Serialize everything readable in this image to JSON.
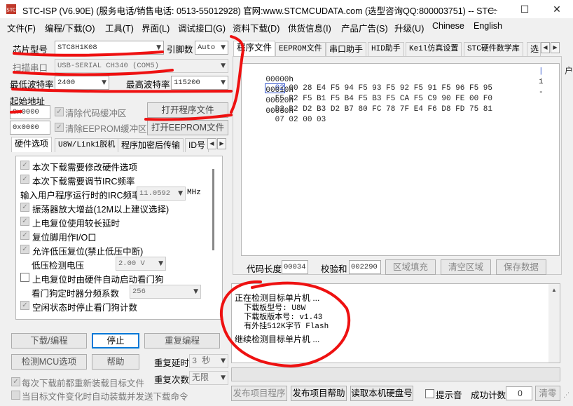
{
  "window": {
    "title": "STC-ISP (V6.90E) (服务电话/销售电话: 0513-55012928) 官网:www.STCMCUDATA.com  (选型咨询QQ:800003751) -- STC:",
    "minimize": "—",
    "maximize": "☐",
    "close": "✕"
  },
  "menu": [
    "文件(F)",
    "编程/下载(O)",
    "工具(T)",
    "界面(L)",
    "调试接口(G)",
    "资料下载(D)",
    "供货信息(I)",
    "产品广告(S)",
    "升级(U)",
    "Chinese",
    "English"
  ],
  "left": {
    "chip_label": "芯片型号",
    "chip_value": "STC8H1K08",
    "pin_label": "引脚数",
    "pin_value": "Auto",
    "port_label": "扫描串口",
    "port_value": "USB-SERIAL CH340 (COM5)",
    "min_baud_label": "最低波特率",
    "min_baud_value": "2400",
    "max_baud_label": "最高波特率",
    "max_baud_value": "115200",
    "start_addr_label": "起始地址",
    "addr1": "0x0000",
    "clear_code": "清除代码缓冲区",
    "open_program": "打开程序文件",
    "addr2": "0x0000",
    "clear_eeprom": "清除EEPROM缓冲区",
    "open_eeprom": "打开EEPROM文件"
  },
  "left_tabs": [
    "硬件选项",
    "U8W/Link1脱机",
    "程序加密后传输",
    "ID号"
  ],
  "options": {
    "o1": "本次下载需要修改硬件选项",
    "o2": "本次下载需要调节IRC频率",
    "irc_label": "输入用户程序运行时的IRC频率",
    "irc_value": "11.0592",
    "irc_unit": "MHz",
    "o3": "振荡器放大增益(12M以上建议选择)",
    "o4": "上电复位使用较长延时",
    "o5": "复位脚用作I/O口",
    "o6": "允许低压复位(禁止低压中断)",
    "lv_label": "低压检测电压",
    "lv_value": "2.00 V",
    "o7": "上电复位时由硬件自动启动看门狗",
    "wdt_label": "看门狗定时器分频系数",
    "wdt_value": "256",
    "o8": "空闲状态时停止看门狗计数"
  },
  "buttons": {
    "download": "下载/编程",
    "stop": "停止",
    "reprogram": "重复编程",
    "detect": "检测MCU选项",
    "help": "帮助",
    "repeat_delay_label": "重复延时",
    "repeat_delay_value": "3 秒",
    "repeat_count_label": "重复次数",
    "repeat_count_value": "无限",
    "reload_each": "每次下载前都重新装载目标文件",
    "auto_load": "当目标文件变化时自动装载并发送下载命令"
  },
  "right_tabs": [
    "程序文件",
    "EEPROM文件",
    "串口助手",
    "HID助手",
    "Keil仿真设置",
    "STC硬件数学库",
    "选"
  ],
  "hex": {
    "rows": [
      {
        "addr": "00000h",
        "bytes": [
          "02",
          "00",
          "28",
          "E4",
          "F5",
          "94",
          "F5",
          "93",
          "F5",
          "92",
          "F5",
          "91",
          "F5",
          "96",
          "F5",
          "95"
        ]
      },
      {
        "addr": "00010h",
        "bytes": [
          "F5",
          "B2",
          "F5",
          "B1",
          "F5",
          "B4",
          "F5",
          "B3",
          "F5",
          "CA",
          "F5",
          "C9",
          "90",
          "FE",
          "00",
          "F0"
        ]
      },
      {
        "addr": "00020h",
        "bytes": [
          "D2",
          "B2",
          "D2",
          "B3",
          "D2",
          "B7",
          "80",
          "FC",
          "78",
          "7F",
          "E4",
          "F6",
          "D8",
          "FD",
          "75",
          "81"
        ]
      },
      {
        "addr": "00030h",
        "bytes": [
          "07",
          "02",
          "00",
          "03"
        ]
      }
    ],
    "ascii_glyphs": [
      "|",
      "i",
      "-"
    ]
  },
  "code_bar": {
    "length_label": "代码长度",
    "length_value": "00034",
    "checksum_label": "校验和",
    "checksum_value": "002290",
    "fill": "区域填充",
    "clear": "清空区域",
    "save": "保存数据"
  },
  "status": {
    "lines": [
      "正在检测目标单片机 ...",
      "  下载板型号: U8W",
      "  下载板版本号: v1.43",
      "  有外挂512K字节 Flash",
      "",
      "继续检测目标单片机 ..."
    ]
  },
  "bottom": {
    "publish": "发布项目程序",
    "publish_help": "发布项目帮助",
    "read_disk": "读取本机硬盘号",
    "prompt_sound": "提示音",
    "success_label": "成功计数",
    "success_value": "0",
    "clear": "清零"
  },
  "edge_glyph": "户"
}
